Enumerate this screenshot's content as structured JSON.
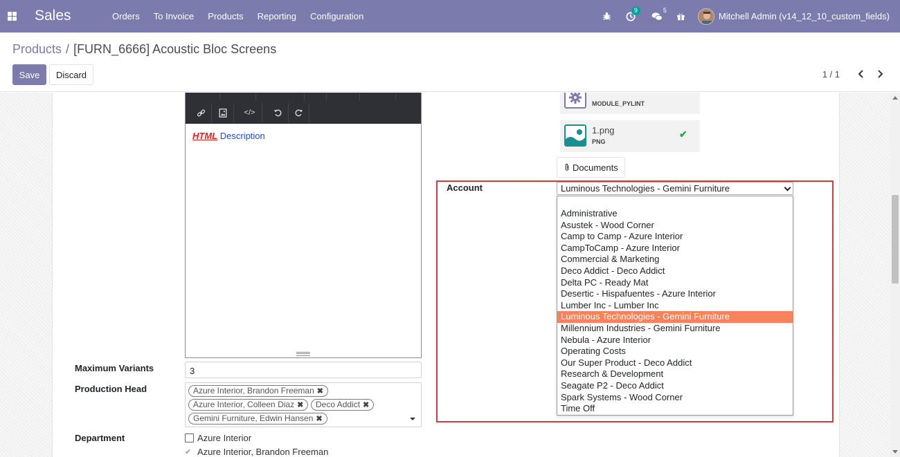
{
  "navbar": {
    "app_name": "Sales",
    "menu": [
      "Orders",
      "To Invoice",
      "Products",
      "Reporting",
      "Configuration"
    ],
    "activity_count": "9",
    "messages_count": "5",
    "user": "Mitchell Admin (v14_12_10_custom_fields)"
  },
  "breadcrumb": {
    "parent": "Products",
    "separator": "/",
    "current": "[FURN_6666] Acoustic Bloc Screens"
  },
  "buttons": {
    "save": "Save",
    "discard": "Discard",
    "documents": "Documents"
  },
  "pager": {
    "value": "1 / 1"
  },
  "editor": {
    "html_word": "HTML",
    "desc_word": "Description"
  },
  "fields": {
    "max_variants_label": "Maximum Variants",
    "max_variants_value": "3",
    "production_head_label": "Production Head",
    "production_head_tags": [
      "Azure Interior, Brandon Freeman",
      "Azure Interior, Colleen Diaz",
      "Deco Addict",
      "Gemini Furniture, Edwin Hansen"
    ],
    "department_label": "Department",
    "department_options": [
      "Azure Interior",
      "Azure Interior, Brandon Freeman"
    ]
  },
  "attachments": [
    {
      "name": "",
      "ext": "MODULE_PYLINT"
    },
    {
      "name": "1.png",
      "ext": "PNG"
    }
  ],
  "account": {
    "label": "Account",
    "selected": "Luminous Technologies - Gemini Furniture",
    "options": [
      "Administrative",
      "Asustek - Wood Corner",
      "Camp to Camp - Azure Interior",
      "CampToCamp - Azure Interior",
      "Commercial & Marketing",
      "Deco Addict - Deco Addict",
      "Delta PC - Ready Mat",
      "Desertic - Hispafuentes - Azure Interior",
      "Lumber Inc - Lumber Inc",
      "Luminous Technologies - Gemini Furniture",
      "Millennium Industries - Gemini Furniture",
      "Nebula - Azure Interior",
      "Operating Costs",
      "Our Super Product - Deco Addict",
      "Research & Development",
      "Seagate P2 - Deco Addict",
      "Spark Systems - Wood Corner",
      "Time Off"
    ]
  },
  "colors": {
    "navbar": "#7c7bad",
    "highlight_border": "#d63b3b",
    "selected_option": "#f6845b",
    "check": "#28a745"
  }
}
